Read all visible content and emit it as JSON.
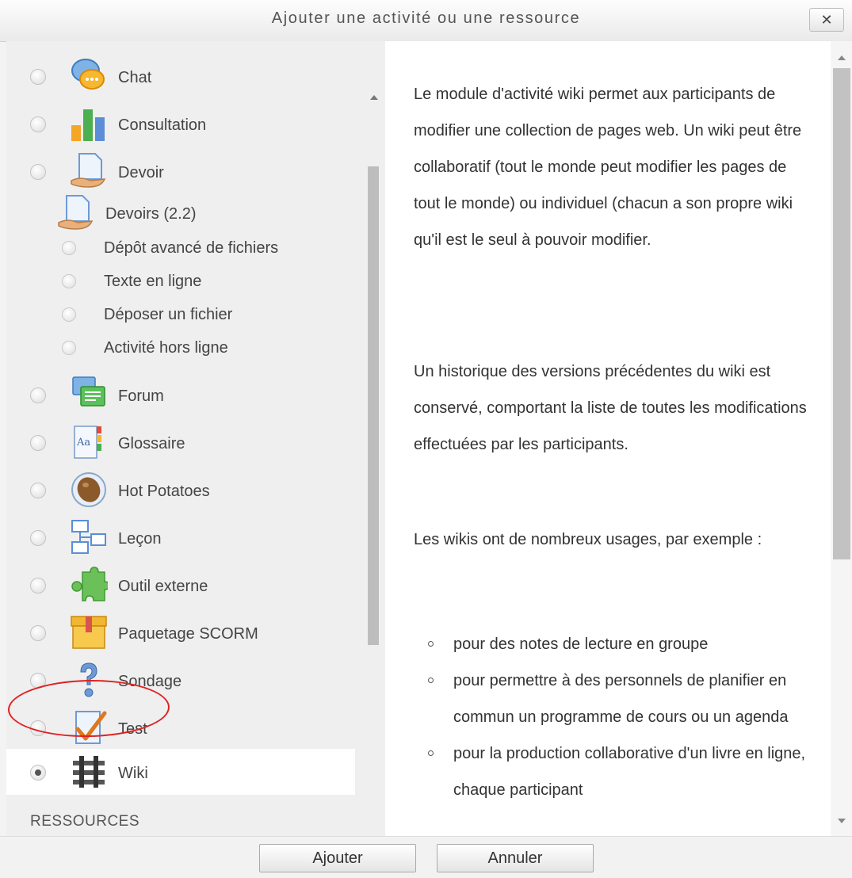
{
  "dialog": {
    "title": "Ajouter une activité ou une ressource",
    "close_label": "✕"
  },
  "activities": [
    {
      "label": "Chat",
      "icon": "chat-icon",
      "selected": false
    },
    {
      "label": "Consultation",
      "icon": "consultation-icon",
      "selected": false
    },
    {
      "label": "Devoir",
      "icon": "devoir-icon",
      "selected": false
    },
    {
      "label": "Forum",
      "icon": "forum-icon",
      "selected": false
    },
    {
      "label": "Glossaire",
      "icon": "glossaire-icon",
      "selected": false
    },
    {
      "label": "Hot Potatoes",
      "icon": "hot-potatoes-icon",
      "selected": false
    },
    {
      "label": "Leçon",
      "icon": "lecon-icon",
      "selected": false
    },
    {
      "label": "Outil externe",
      "icon": "outil-externe-icon",
      "selected": false
    },
    {
      "label": "Paquetage SCORM",
      "icon": "scorm-icon",
      "selected": false
    },
    {
      "label": "Sondage",
      "icon": "sondage-icon",
      "selected": false
    },
    {
      "label": "Test",
      "icon": "test-icon",
      "selected": false
    },
    {
      "label": "Wiki",
      "icon": "wiki-icon",
      "selected": true
    }
  ],
  "devoirs_group": {
    "label": "Devoirs (2.2)",
    "subitems": [
      {
        "label": "Dépôt avancé de fichiers"
      },
      {
        "label": "Texte en ligne"
      },
      {
        "label": "Déposer un fichier"
      },
      {
        "label": "Activité hors ligne"
      }
    ]
  },
  "section_resources": "RESSOURCES",
  "description": {
    "p1": "Le module d'activité wiki permet aux participants de modifier une collection de pages web. Un wiki peut être collaboratif (tout le monde peut modifier les pages de tout le monde) ou individuel (chacun a son propre wiki qu'il est le seul à pouvoir modifier.",
    "p2": "Un historique des versions précédentes du wiki est conservé, comportant la liste de toutes les modifications effectuées par les participants.",
    "p3": "Les wikis ont de nombreux usages, par exemple :",
    "list": [
      "pour des notes de lecture en groupe",
      "pour permettre à des personnels de planifier en commun un programme de cours ou un agenda",
      "pour la production collaborative d'un livre en ligne, chaque participant"
    ]
  },
  "footer": {
    "add_label": "Ajouter",
    "cancel_label": "Annuler"
  }
}
